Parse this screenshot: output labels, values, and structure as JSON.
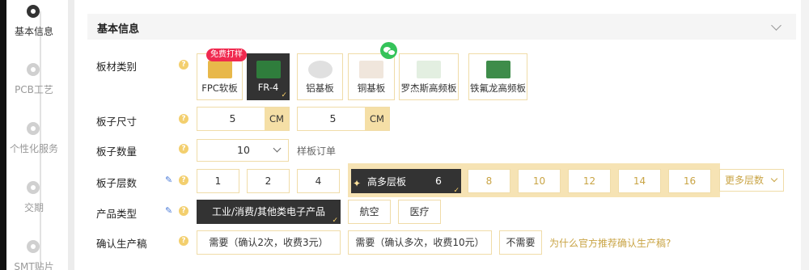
{
  "steps": [
    {
      "label": "基本信息",
      "state": "active"
    },
    {
      "label": "PCB工艺",
      "state": "pending"
    },
    {
      "label": "个性化服务",
      "state": "pending"
    },
    {
      "label": "交期",
      "state": "pending"
    },
    {
      "label": "SMT贴片",
      "state": "pending"
    }
  ],
  "section": {
    "title": "基本信息"
  },
  "rows": {
    "board_type": "板材类别",
    "board_size": "板子尺寸",
    "board_qty": "板子数量",
    "layers": "板子层数",
    "product_type": "产品类型",
    "confirm_draft": "确认生产稿"
  },
  "help_glyph": "?",
  "materials": [
    {
      "label": "FPC软板",
      "selected": false,
      "color": "#e8b84a"
    },
    {
      "label": "FR-4",
      "selected": true,
      "color": "#2f7d3c"
    },
    {
      "label": "铝基板",
      "selected": false,
      "color": "#d6d6d6"
    },
    {
      "label": "铜基板",
      "selected": false,
      "color": "#c98a64"
    },
    {
      "label": "罗杰斯高频板",
      "selected": false,
      "color": "#5a9a5e"
    },
    {
      "label": "铁氟龙高频板",
      "selected": false,
      "color": "#3e8c4a"
    }
  ],
  "free_badge": "免费打样",
  "size": {
    "width": "5",
    "height": "5",
    "unit": "CM"
  },
  "quantity": {
    "value": "10",
    "note": "样板订单"
  },
  "layer_options": [
    "1",
    "2",
    "4"
  ],
  "multi_layer": {
    "label": "高多层板",
    "selected": "6",
    "options": [
      "8",
      "10",
      "12",
      "14",
      "16"
    ],
    "more": "更多层数"
  },
  "product_types": [
    {
      "label": "工业/消费/其他类电子产品",
      "selected": true
    },
    {
      "label": "航空",
      "selected": false
    },
    {
      "label": "医疗",
      "selected": false
    }
  ],
  "confirm_options": [
    {
      "label": "需要（确认2次，收费3元）",
      "selected": false
    },
    {
      "label": "需要（确认多次，收费10元）",
      "selected": false
    },
    {
      "label": "不需要",
      "selected": false
    }
  ],
  "confirm_link": "为什么官方推荐确认生产稿?",
  "colors": {
    "accent": "#c9a445",
    "selected": "#333333",
    "border": "#f0dca8",
    "unit_bg": "#f5dfa6",
    "badge": "#f0294f",
    "wechat": "#35c35a"
  }
}
